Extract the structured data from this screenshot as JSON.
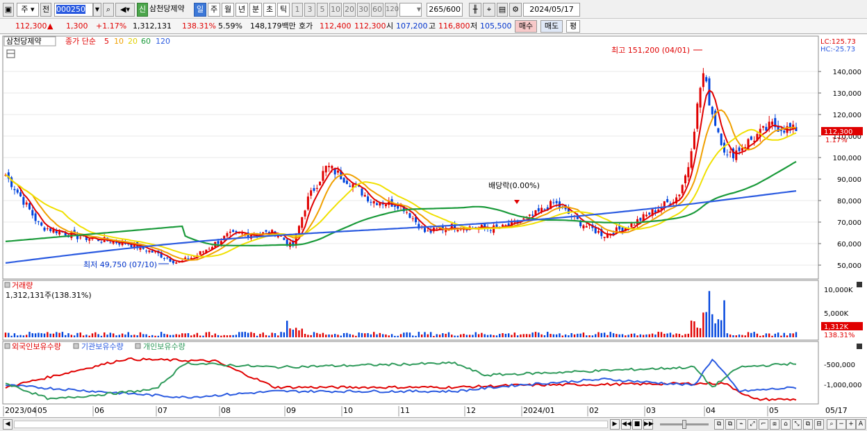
{
  "toolbar": {
    "market": "주",
    "prev_label": "전",
    "code": "000250",
    "new_badge": "신",
    "stock_name": "삼천당제약",
    "periods": [
      "일",
      "주",
      "월",
      "년",
      "분",
      "초",
      "틱"
    ],
    "active_period": "일",
    "intervals": [
      "1",
      "3",
      "5",
      "10",
      "20",
      "30",
      "60",
      "120"
    ],
    "count": "265",
    "count_max": "/600",
    "date": "2024/05/17"
  },
  "quote": {
    "price": "112,300",
    "arrow": "▲",
    "change": "1,300",
    "change_pct": "+1.17%",
    "volume": "1,312,131",
    "volume_pct": "138.31%",
    "turnover": "5.59%",
    "amount": "148,179백만",
    "hoga_label": "호가",
    "ask": "112,400",
    "bid": "112,300",
    "open_label": "시",
    "open": "107,200",
    "high_label": "고",
    "high": "116,800",
    "low_label": "저",
    "low": "105,500",
    "buy_label": "매수",
    "sell_label": "매도",
    "eval_label": "평"
  },
  "price_panel": {
    "stock_tag": "삼천당제약",
    "ma_prefix": "종가 단순",
    "ma_periods": [
      "5",
      "10",
      "20",
      "60",
      "120"
    ],
    "ma_colors": [
      "#e00000",
      "#f0a000",
      "#f0e000",
      "#1a9a3a",
      "#2a5ae0"
    ],
    "lc": "LC:125.73",
    "hc": "HC:-25.73",
    "y_ticks": [
      "140,000",
      "130,000",
      "120,000",
      "110,000",
      "100,000",
      "90,000",
      "80,000",
      "70,000",
      "60,000",
      "50,000"
    ],
    "last_price_tag": "112,300",
    "last_pct_tag": "1.17%",
    "annot_high": "최고 151,200 (04/01)",
    "annot_low": "최저 49,750 (07/10)",
    "annot_div": "배당락(0.00%)"
  },
  "volume_panel": {
    "title": "거래량",
    "value": "1,312,131주(138.31%)",
    "y_ticks": [
      "10,000K",
      "5,000K"
    ],
    "last_tag": "1,312K",
    "last_pct": "138.31%"
  },
  "holdings_panel": {
    "series": [
      {
        "name": "외국인보유수량",
        "color": "#e00000"
      },
      {
        "name": "기관보유수량",
        "color": "#2a5ae0"
      },
      {
        "name": "개인보유수량",
        "color": "#2e9a5a"
      }
    ],
    "y_ticks": [
      "-500,000",
      "-1,000,000"
    ]
  },
  "x_axis": {
    "labels": [
      "2023/04",
      "05",
      "06",
      "07",
      "08",
      "09",
      "10",
      "11",
      "12",
      "2024/01",
      "02",
      "03",
      "04",
      "05"
    ],
    "end_label": "05/17"
  },
  "chart_data": {
    "type": "candlestick",
    "title": "삼천당제약",
    "ylim": [
      45000,
      155000
    ],
    "x": [
      "2023/04",
      "2023/05",
      "2023/06",
      "2023/07",
      "2023/08",
      "2023/09",
      "2023/10",
      "2023/11",
      "2023/12",
      "2024/01",
      "2024/02",
      "2024/03",
      "2024/04",
      "2024/05"
    ],
    "close_approx": [
      93000,
      65000,
      62000,
      51000,
      63000,
      95000,
      78000,
      67000,
      68000,
      79000,
      63000,
      74000,
      140000,
      112300
    ],
    "ma120_approx": [
      51000,
      58000,
      64000,
      66000,
      68000,
      70000,
      72000,
      72000,
      72000,
      73000,
      73000,
      73000,
      77000,
      84000
    ]
  }
}
